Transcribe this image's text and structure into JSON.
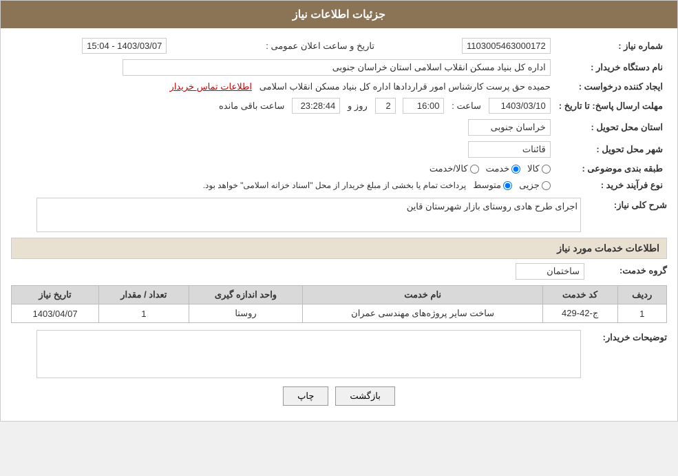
{
  "header": {
    "title": "جزئیات اطلاعات نیاز"
  },
  "fields": {
    "shomareNiaz_label": "شماره نیاز :",
    "shomareNiaz_value": "1103005463000172",
    "namDastgah_label": "نام دستگاه خریدار :",
    "namDastgah_value": "اداره کل بنیاد مسکن انقلاب اسلامی استان خراسان جنوبی",
    "ijadKonande_label": "ایجاد کننده درخواست :",
    "ijadKonande_value": "حمیده حق پرست کارشناس امور قراردادها اداره کل بنیاد مسکن انقلاب اسلامی",
    "contactInfo": "اطلاعات تماس خریدار",
    "tarikhErsal_label": "مهلت ارسال پاسخ: تا تاریخ :",
    "tarikhErsal_date": "1403/03/10",
    "tarikhErsal_saat_label": "ساعت :",
    "tarikhErsal_saat": "16:00",
    "tarikhErsal_rooz_label": "روز و",
    "tarikhErsal_rooz": "2",
    "tarikhErsal_countdown": "23:28:44",
    "tarikhErsal_remaining": "ساعت باقی مانده",
    "tarikhAelaan_label": "تاریخ و ساعت اعلان عمومی :",
    "tarikhAelaan_value": "1403/03/07 - 15:04",
    "ostan_label": "استان محل تحویل :",
    "ostan_value": "خراسان جنوبی",
    "shahr_label": "شهر محل تحویل :",
    "shahr_value": "قائنات",
    "tabaqebandi_label": "طبقه بندی موضوعی :",
    "tabaqebandi_kala": "کالا",
    "tabaqebandi_khedmat": "خدمت",
    "tabaqebandi_kala_khedmat": "کالا/خدمت",
    "tabaqebandi_selected": "khedmat",
    "noeFarayand_label": "نوع فرآیند خرید :",
    "noeFarayand_jozi": "جزیی",
    "noeFarayand_mottaset": "متوسط",
    "noeFarayand_note": "پرداخت تمام یا بخشی از مبلغ خریدار از محل \"اسناد خزانه اسلامی\" خواهد بود.",
    "noeFarayand_selected": "mottaset",
    "sharhKolliNiaz_label": "شرح کلی نیاز:",
    "sharhKolliNiaz_value": "اجرای طرح هادی روستای بازار شهرستان قاین",
    "khadamatSection": "اطلاعات خدمات مورد نیاز",
    "groheKhedmat_label": "گروه خدمت:",
    "groheKhedmat_value": "ساختمان",
    "tableHeaders": {
      "radif": "ردیف",
      "kodKhedmat": "کد خدمت",
      "namKhedmat": "نام خدمت",
      "vahadAndazeGiri": "واحد اندازه گیری",
      "tedad_megdar": "تعداد / مقدار",
      "tarikhNiaz": "تاریخ نیاز"
    },
    "tableRows": [
      {
        "radif": "1",
        "kodKhedmat": "ج-42-429",
        "namKhedmat": "ساخت سایر پروژه‌های مهندسی عمران",
        "vahadAndazeGiri": "روستا",
        "tedad_megdar": "1",
        "tarikhNiaz": "1403/04/07"
      }
    ],
    "tozihatKharidar_label": "توضیحات خریدار:",
    "tozihatKharidar_value": ""
  },
  "buttons": {
    "chap": "چاپ",
    "bazgasht": "بازگشت"
  }
}
